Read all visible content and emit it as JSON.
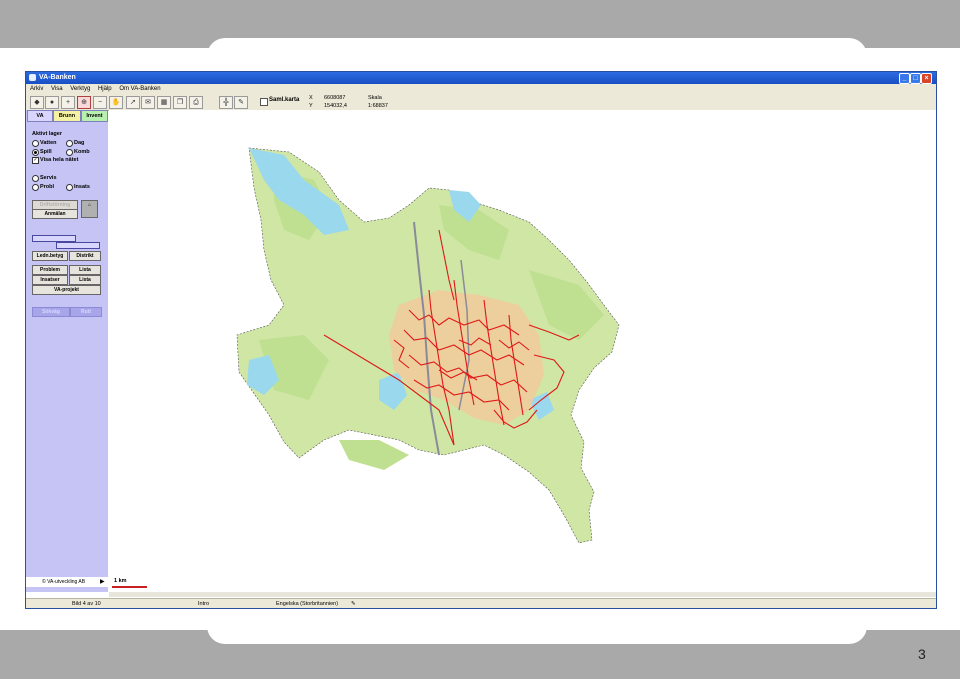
{
  "page_number": "3",
  "window": {
    "title": "VA-Banken",
    "buttons": {
      "minimize": "_",
      "maximize": "□",
      "close": "×"
    }
  },
  "menu": [
    "Arkiv",
    "Visa",
    "Verktyg",
    "Hjälp",
    "Om VA-Banken"
  ],
  "toolbar": {
    "samlkarta_label": "Saml.karta",
    "x_label": "X",
    "y_label": "Y",
    "x_value": "6608087",
    "y_value": "154032,4",
    "skala_label": "Skala",
    "skala_value": "1:68837"
  },
  "sidebar": {
    "tabs": [
      "VA",
      "Brunn",
      "Invent"
    ],
    "aktivt_lager": "Aktivt lager",
    "vatten": "Vatten",
    "dag": "Dag",
    "spill": "Spill",
    "komb": "Komb",
    "visa_hela": "Visa hela nätet",
    "servis": "Servis",
    "probl": "Probl",
    "insats": "Insats",
    "driftstorning": "Driftstörning",
    "anmalan": "Anmälan",
    "lednbetyg": "Ledn.betyg",
    "distrikt": "Distrikt",
    "problem": "Problem",
    "lista1": "Lista",
    "insatser": "Insatser",
    "lista2": "Lista",
    "vaprojekt": "VA-projekt",
    "sok": "Sökväg",
    "rutt": "Rutt",
    "footer": "© VA-utveckling AB"
  },
  "map": {
    "scale_label": "1 km",
    "colors": {
      "land": "#cfe6a4",
      "forest": "#bfe090",
      "water": "#9ad8ee",
      "urban": "#f3c99a",
      "pipes": "#e01818"
    }
  },
  "status": {
    "slide": "Bild 4 av 10",
    "section": "Intro",
    "language": "Engelska (Storbritannien)"
  }
}
